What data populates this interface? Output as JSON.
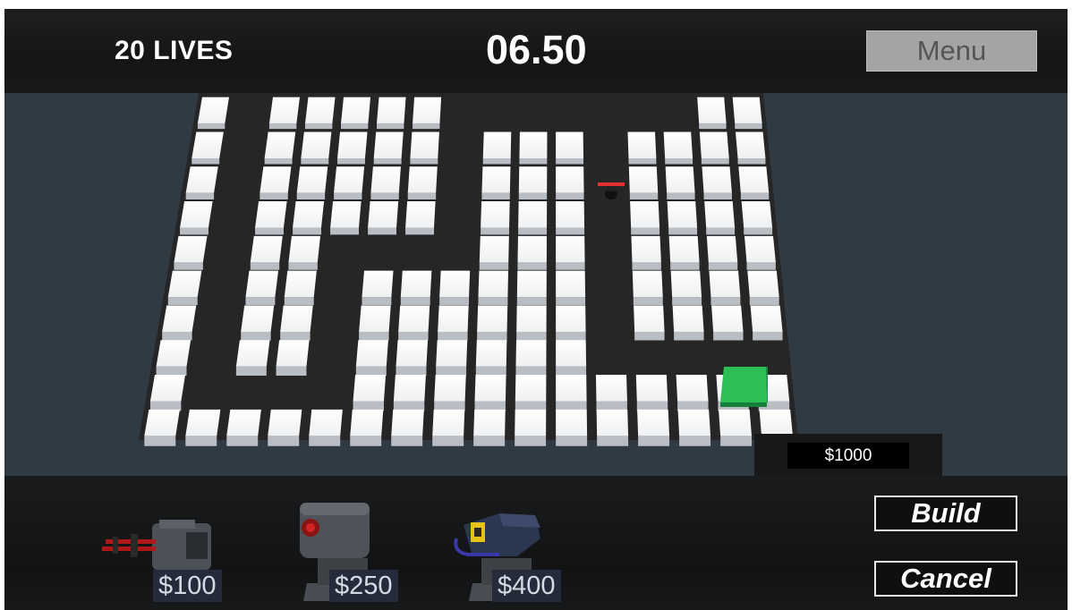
{
  "hud": {
    "lives": "20 LIVES",
    "timer": "06.50",
    "menu_label": "Menu"
  },
  "shop": {
    "money": "$1000",
    "build_label": "Build",
    "cancel_label": "Cancel",
    "towers": [
      {
        "price": "$100",
        "icon": "gatling-turret-icon"
      },
      {
        "price": "$250",
        "icon": "cannon-turret-icon"
      },
      {
        "price": "$400",
        "icon": "laser-turret-icon"
      }
    ]
  },
  "colors": {
    "tile": "#ffffff",
    "path": "#262626",
    "goal": "#22b24c",
    "enemy": "#e03030"
  }
}
